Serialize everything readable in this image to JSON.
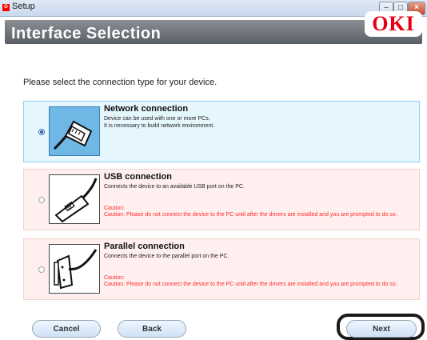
{
  "window": {
    "title": "Setup"
  },
  "header": {
    "title": "Interface Selection",
    "logo_text": "OKI"
  },
  "prompt": "Please select the connection type for your device.",
  "options": [
    {
      "title": "Network connection",
      "desc1": "Device can be used with one or more PCs.",
      "desc2": "It is necessary to build network environment.",
      "selected": true
    },
    {
      "title": "USB connection",
      "desc1": "Connects the device to an available USB port on the PC.",
      "caution_label": "Caution:",
      "caution_text": "Caution: Please do not connect the device to the PC until after the drivers are installed and you are prompted to do so.",
      "selected": false
    },
    {
      "title": "Parallel connection",
      "desc1": "Connects the device to the parallel port on the PC.",
      "caution_label": "Caution:",
      "caution_text": "Caution: Please do not connect the device to the PC until after the drivers are installed and you are prompted to do so.",
      "selected": false
    }
  ],
  "buttons": {
    "cancel": "Cancel",
    "back": "Back",
    "next": "Next"
  },
  "colors": {
    "accent": "#e60012",
    "network_bg": "#e6f6fd",
    "caution": "#ff2a2a"
  }
}
